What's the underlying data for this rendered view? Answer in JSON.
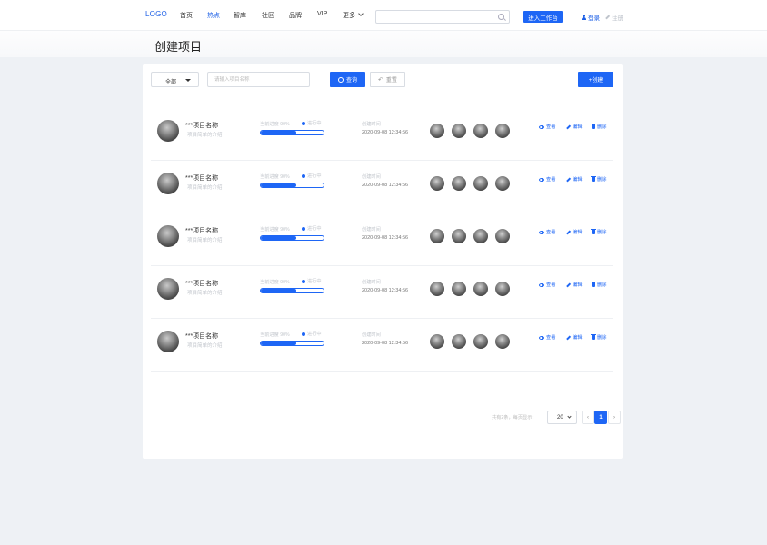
{
  "nav": {
    "logo": "LOGO",
    "items": [
      {
        "label": "首页",
        "active": false
      },
      {
        "label": "热点",
        "active": true
      },
      {
        "label": "智库",
        "active": false
      },
      {
        "label": "社区",
        "active": false
      },
      {
        "label": "品牌",
        "active": false
      },
      {
        "label": "VIP",
        "active": false
      },
      {
        "label": "更多",
        "active": false
      }
    ],
    "search_placeholder": "",
    "workbench_label": "进入工作台",
    "login_label": "登录",
    "register_label": "注册"
  },
  "page": {
    "title": "创建项目"
  },
  "toolbar": {
    "filter_value": "全部",
    "name_placeholder": "请输入项目名称",
    "query_label": "查询",
    "reset_label": "重置",
    "create_label": "+创建"
  },
  "projects": [
    {
      "name": "***项目名称",
      "desc": "项目简单的介绍",
      "progress_label": "当前进度 90%",
      "progress": 0.57,
      "status": "进行中",
      "time_label": "创建时间",
      "time": "2020-09-08 12:34:56",
      "actions": {
        "view": "查看",
        "edit": "编辑",
        "delete": "删除"
      }
    },
    {
      "name": "***项目名称",
      "desc": "项目简单的介绍",
      "progress_label": "当前进度 90%",
      "progress": 0.57,
      "status": "进行中",
      "time_label": "创建时间",
      "time": "2020-09-08 12:34:56",
      "actions": {
        "view": "查看",
        "edit": "编辑",
        "delete": "删除"
      }
    },
    {
      "name": "***项目名称",
      "desc": "项目简单的介绍",
      "progress_label": "当前进度 90%",
      "progress": 0.57,
      "status": "进行中",
      "time_label": "创建时间",
      "time": "2020-09-08 12:34:56",
      "actions": {
        "view": "查看",
        "edit": "编辑",
        "delete": "删除"
      }
    },
    {
      "name": "***项目名称",
      "desc": "项目简单的介绍",
      "progress_label": "当前进度 90%",
      "progress": 0.57,
      "status": "进行中",
      "time_label": "创建时间",
      "time": "2020-09-08 12:34:56",
      "actions": {
        "view": "查看",
        "edit": "编辑",
        "delete": "删除"
      }
    },
    {
      "name": "***项目名称",
      "desc": "项目简单的介绍",
      "progress_label": "当前进度 90%",
      "progress": 0.57,
      "status": "进行中",
      "time_label": "创建时间",
      "time": "2020-09-08 12:34:56",
      "actions": {
        "view": "查看",
        "edit": "编辑",
        "delete": "删除"
      }
    }
  ],
  "pagination": {
    "total_text": "共有2条，每页显示：",
    "page_size": "20",
    "prev": "‹",
    "current": "1",
    "next": "›"
  },
  "colors": {
    "accent": "#1e66f5",
    "background": "#eef1f5",
    "muted_text": "#c2c6cc"
  },
  "icons": {
    "search": "search-icon",
    "user": "user-icon",
    "edit": "edit-icon",
    "view": "eye-icon",
    "delete": "trash-icon",
    "reset": "undo-icon"
  }
}
